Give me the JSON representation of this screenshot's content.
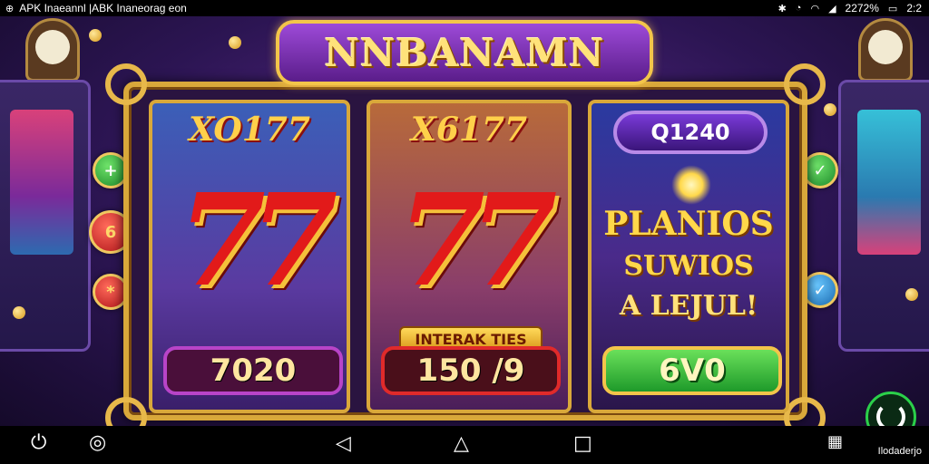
{
  "status_bar": {
    "app_label": "APK Inaeannl |ABK Inaneorag eon",
    "battery": "2272%",
    "time": "2:2"
  },
  "title": "NNBANAMN",
  "reels": [
    {
      "label": "XO177",
      "symbol": "77",
      "value": "7020"
    },
    {
      "label": "X6177",
      "symbol": "77",
      "ribbon": "INTERAK TIES",
      "value": "150 /9"
    },
    {
      "pill": "Q1240",
      "promo": [
        "PLANIOS",
        "SUWIOS",
        "A LEJUL!"
      ],
      "value": "6V0"
    }
  ],
  "side_buttons": {
    "left": [
      "+",
      "6",
      "*"
    ],
    "right": [
      "check",
      "check"
    ]
  },
  "nav_bar": {
    "right_label": "Ilodaderjo"
  },
  "colors": {
    "frame_gold": "#d9a83a",
    "banner_purple": "#5a1d8a",
    "seven_red": "#e21a1a",
    "win_green": "#1e9a2a"
  }
}
